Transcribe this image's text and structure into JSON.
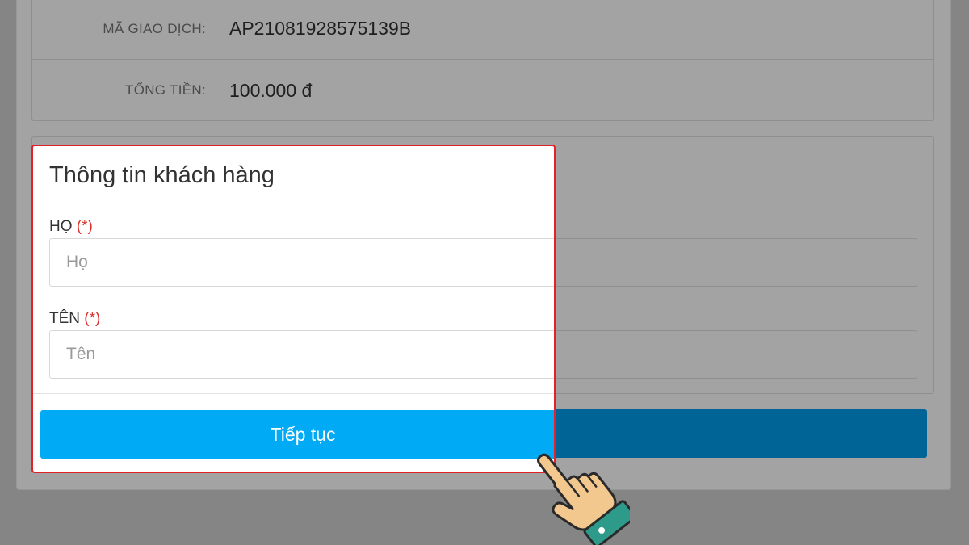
{
  "summary": {
    "transaction_label": "MÃ GIAO DỊCH:",
    "transaction_value": "AP21081928575139B",
    "total_label": "TỔNG TIỀN:",
    "total_value": "100.000 đ"
  },
  "form": {
    "title": "Thông tin khách hàng",
    "last_name_label": "HỌ",
    "last_name_required": "(*)",
    "last_name_placeholder": "Họ",
    "first_name_label": "TÊN",
    "first_name_required": "(*)",
    "first_name_placeholder": "Tên",
    "continue_label": "Tiếp tục"
  },
  "colors": {
    "highlight_border": "#e2222a",
    "button": "#00aaf5",
    "required": "#d9302c"
  },
  "icons": {
    "pointer": "pointing-hand-icon"
  }
}
